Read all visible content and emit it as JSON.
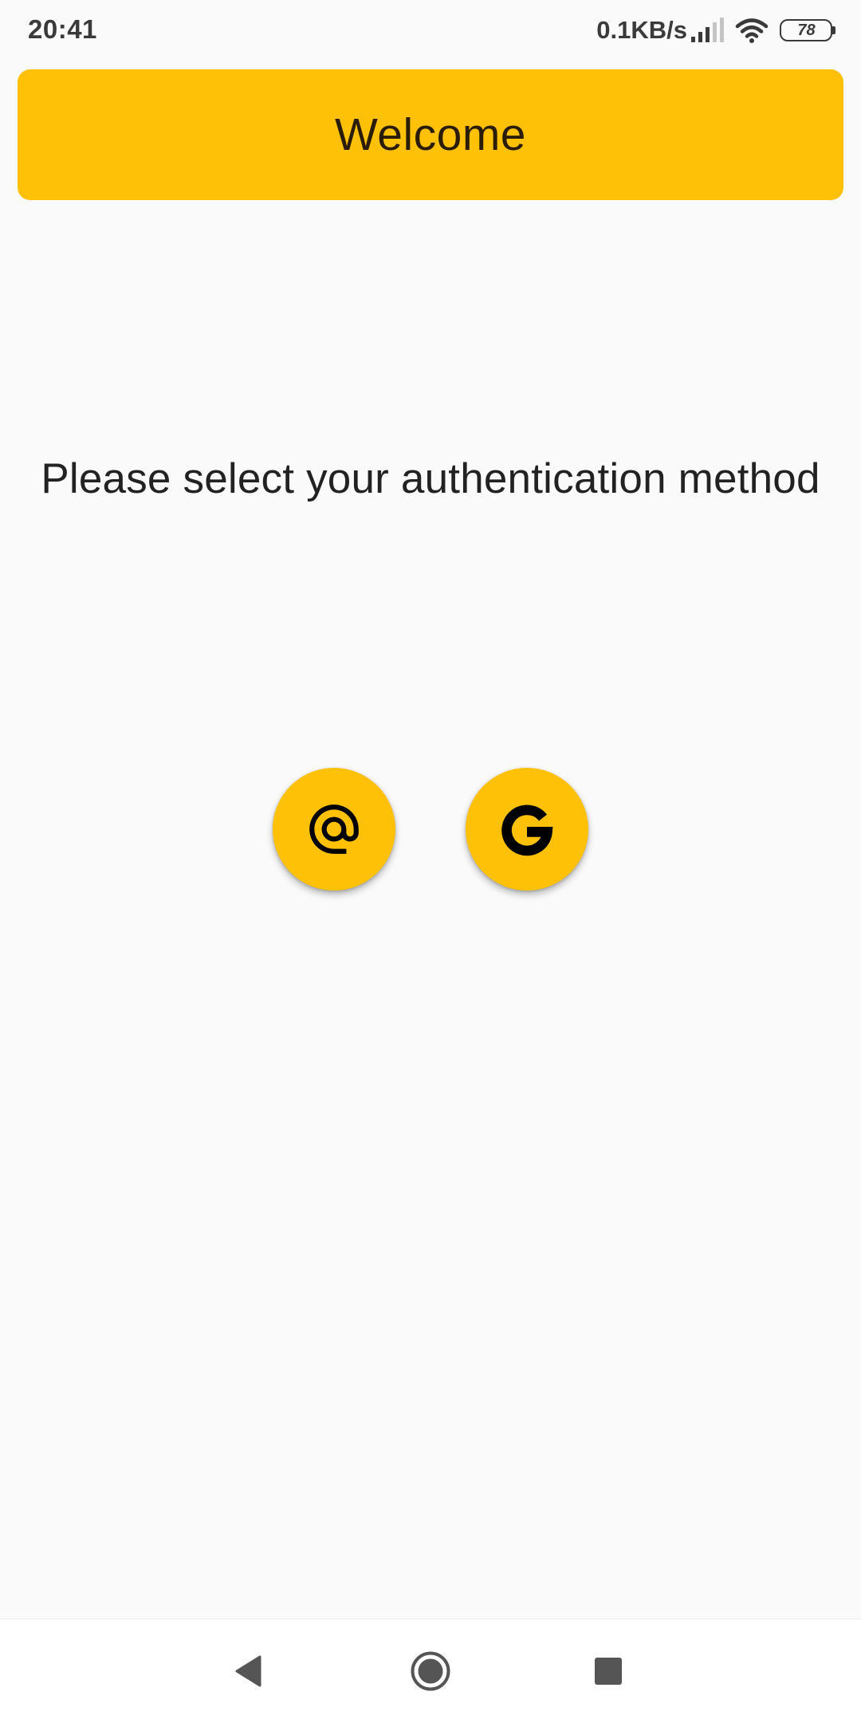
{
  "status_bar": {
    "time": "20:41",
    "net_speed": "0.1KB/s",
    "battery_level": "78",
    "icons": [
      "signal-icon",
      "wifi-icon",
      "battery-icon"
    ]
  },
  "app_bar": {
    "title": "Welcome"
  },
  "main": {
    "prompt": "Please select your authentication method",
    "auth_buttons": [
      {
        "name": "email-auth-button",
        "icon": "at-sign-icon"
      },
      {
        "name": "google-auth-button",
        "icon": "google-g-icon"
      }
    ]
  },
  "nav_bar": {
    "buttons": [
      "back-icon",
      "home-icon",
      "recents-icon"
    ]
  },
  "colors": {
    "accent": "#ffc107",
    "background": "#fafafa",
    "text": "#222222"
  }
}
